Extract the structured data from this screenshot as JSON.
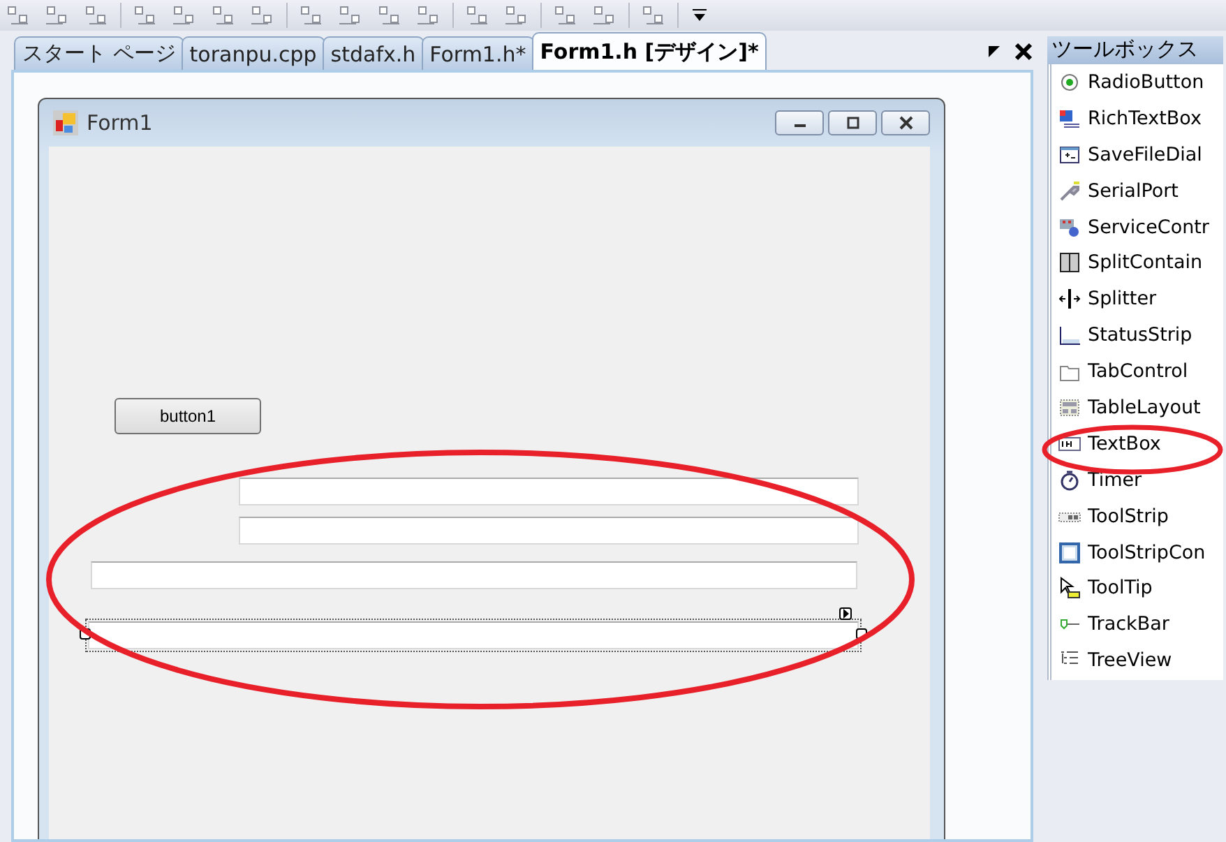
{
  "document_tabs": [
    {
      "label": "スタート ページ",
      "selected": false
    },
    {
      "label": "toranpu.cpp",
      "selected": false
    },
    {
      "label": "stdafx.h",
      "selected": false
    },
    {
      "label": "Form1.h*",
      "selected": false
    },
    {
      "label": "Form1.h [デザイン]*",
      "selected": true
    }
  ],
  "designer": {
    "form": {
      "title": "Form1",
      "button": {
        "label": "button1"
      },
      "textboxes": [
        {
          "selected": false
        },
        {
          "selected": false
        },
        {
          "selected": false
        },
        {
          "selected": true
        }
      ]
    }
  },
  "toolbox": {
    "title": "ツールボックス",
    "items": [
      {
        "label": "RadioButton"
      },
      {
        "label": "RichTextBox"
      },
      {
        "label": "SaveFileDial"
      },
      {
        "label": "SerialPort"
      },
      {
        "label": "ServiceContr"
      },
      {
        "label": "SplitContain"
      },
      {
        "label": "Splitter"
      },
      {
        "label": "StatusStrip"
      },
      {
        "label": "TabControl"
      },
      {
        "label": "TableLayout"
      },
      {
        "label": "TextBox"
      },
      {
        "label": "Timer"
      },
      {
        "label": "ToolStrip"
      },
      {
        "label": "ToolStripCon"
      },
      {
        "label": "ToolTip"
      },
      {
        "label": "TrackBar"
      },
      {
        "label": "TreeView"
      }
    ]
  }
}
